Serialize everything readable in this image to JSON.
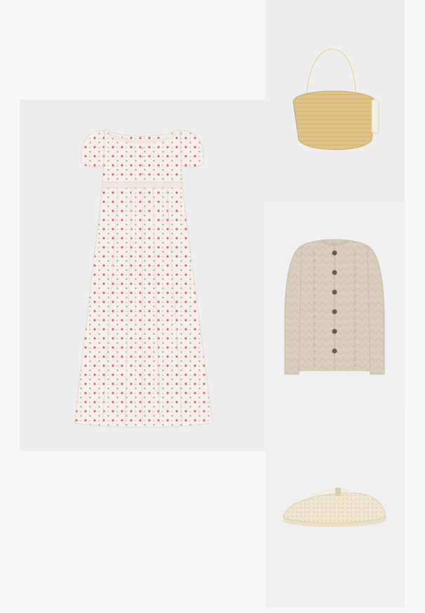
{
  "products": [
    {
      "id": "dress",
      "icon": "floral-midi-dress"
    },
    {
      "id": "bag",
      "icon": "straw-shoulder-bag"
    },
    {
      "id": "cardigan",
      "icon": "cable-knit-cardigan"
    },
    {
      "id": "shoe",
      "icon": "mesh-ballet-flat"
    }
  ],
  "colors": {
    "page_background": "#f7f7f7",
    "card_background": "#eeeeef",
    "dress_base": "#f6efe9",
    "dress_print": "#c9657a",
    "bag_straw": "#e2c58a",
    "bag_leather": "#f4efe3",
    "cardigan_knit": "#d9cdbd",
    "cardigan_button": "#6b5a4c",
    "shoe_mesh": "#efe6cf"
  }
}
